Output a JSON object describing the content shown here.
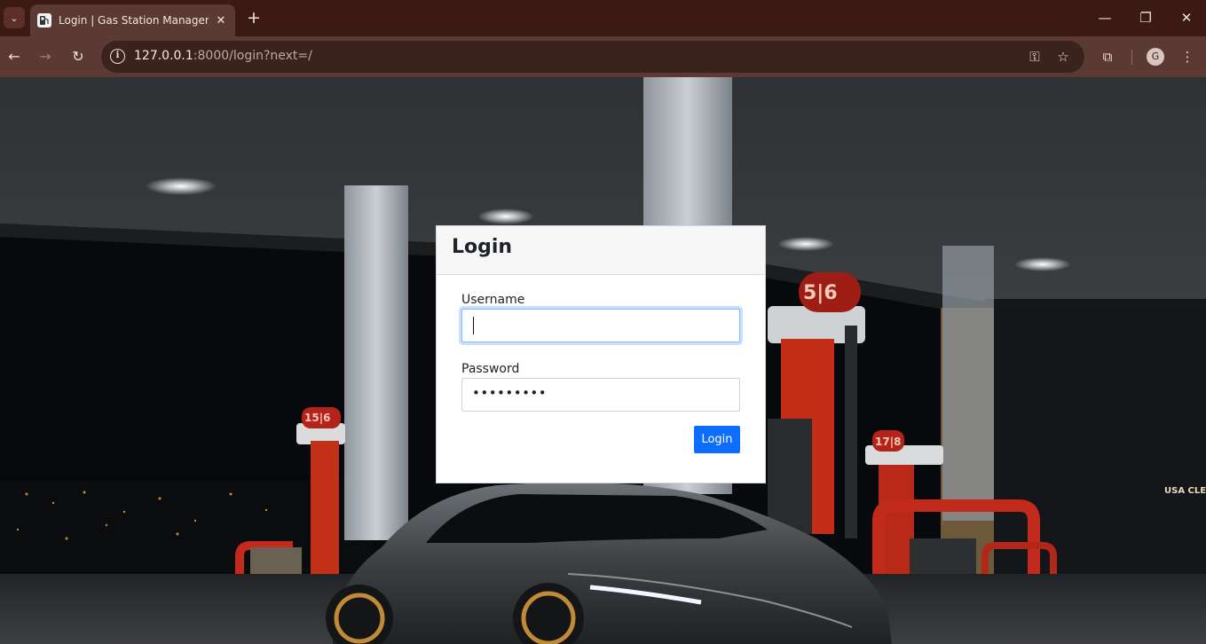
{
  "browser": {
    "tab_title": "Login | Gas Station Management",
    "url_host": "127.0.0.1",
    "url_path": ":8000/login?next=/",
    "avatar_letter": "G",
    "colors": {
      "frame": "#3b1a14",
      "toolbar": "#5a3a33",
      "omnibox": "#3c221d"
    }
  },
  "login": {
    "title": "Login",
    "username_label": "Username",
    "username_value": "",
    "password_label": "Password",
    "password_mask": "•••••••••",
    "submit_label": "Login"
  },
  "background": {
    "sign_pump_left": "15|6",
    "sign_pump_center": "5|6",
    "sign_pump_right": "17|8",
    "store_sign": "USA CLEA"
  },
  "colors": {
    "primary": "#0d6efd",
    "card_header": "#f7f7f7"
  }
}
